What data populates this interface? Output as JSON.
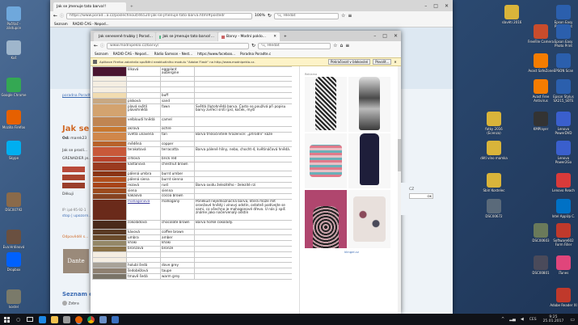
{
  "desktop": {
    "left_icons": [
      {
        "label": "Počítač - zástupce",
        "icon": "computer-icon",
        "color": "#6fa8dc"
      },
      {
        "label": "Koš",
        "icon": "recycle-bin-icon",
        "color": "#9fb6cc"
      },
      {
        "label": "Google Chrome",
        "icon": "chrome-icon",
        "color": "#34a853"
      },
      {
        "label": "Mozilla Firefox",
        "icon": "firefox-icon",
        "color": "#e66000"
      },
      {
        "label": "Skype",
        "icon": "skype-icon",
        "color": "#00aff0"
      },
      {
        "label": "DSC00792",
        "icon": "photo-icon",
        "color": "#8a6a4a"
      },
      {
        "label": "Eva Hrdinová",
        "icon": "photo-icon",
        "color": "#6a5040"
      },
      {
        "label": "Dropbox",
        "icon": "dropbox-icon",
        "color": "#0061fe"
      },
      {
        "label": "kostel",
        "icon": "photo-icon",
        "color": "#7a7a6a"
      }
    ],
    "right_icons": [
      {
        "label": "slavěti 2016",
        "icon": "folder-icon",
        "color": "#d9b43a"
      },
      {
        "label": "Epson Easy Photo Print",
        "icon": "printer-icon",
        "color": "#2b5fad"
      },
      {
        "label": "FreeFile Camera",
        "icon": "app-icon",
        "color": "#c94c2c"
      },
      {
        "label": "Epson Easy Photo Print",
        "icon": "printer-icon",
        "color": "#2b5fad"
      },
      {
        "label": "Avast SafeZone",
        "icon": "avast-icon",
        "color": "#f57c00"
      },
      {
        "label": "EPSON Scan",
        "icon": "scanner-icon",
        "color": "#2b5fad"
      },
      {
        "label": "Avast Free Antivirus",
        "icon": "avast-icon",
        "color": "#f57c00"
      },
      {
        "label": "Epson Stylus SX215_S0TE",
        "icon": "printer-icon",
        "color": "#2b5fad"
      },
      {
        "label": "fotky 2016 (Ecenza)",
        "icon": "folder-icon",
        "color": "#d9b43a"
      },
      {
        "label": "KMPlayer",
        "icon": "player-icon",
        "color": "#333333"
      },
      {
        "label": "Lenovo PowerDVD",
        "icon": "dvd-icon",
        "color": "#3a5fcd"
      },
      {
        "label": "dětí víno mamka",
        "icon": "folder-icon",
        "color": "#d9b43a"
      },
      {
        "label": "Lenovo Power2Go",
        "icon": "disc-icon",
        "color": "#3a5fcd"
      },
      {
        "label": "Sbírí Kostelec",
        "icon": "folder-icon",
        "color": "#d9b43a"
      },
      {
        "label": "Lenovo Reach",
        "icon": "app-icon",
        "color": "#d93a3a"
      },
      {
        "label": "DSC00672",
        "icon": "photo-icon",
        "color": "#5a6a7a"
      },
      {
        "label": "Intel AppUp C.",
        "icon": "app-icon",
        "color": "#0071c5"
      },
      {
        "label": "DSC00603",
        "icon": "photo-icon",
        "color": "#6a7a5a"
      },
      {
        "label": "Software602 Form Filler",
        "icon": "app-icon",
        "color": "#c0392b"
      },
      {
        "label": "DSC00801",
        "icon": "photo-icon",
        "color": "#4a4a5a"
      },
      {
        "label": "iTunes",
        "icon": "itunes-icon",
        "color": "#e0457b"
      },
      {
        "label": "Adobe Reader XI",
        "icon": "pdf-icon",
        "color": "#c0392b"
      }
    ]
  },
  "back_browser": {
    "tabs": [
      "Jak se jmenuje tato barva!!",
      "+"
    ],
    "url": "https://www.porad...a.cz/poslechnout/46520-jak-se-jmenuje-tato-barva.html#postedr",
    "zoom": "100%",
    "search_placeholder": "Hledat",
    "bookmarks": [
      "Seznam",
      "RADIO ČAS - Nepod..."
    ],
    "page": {
      "breadcrumb": "poradna Poradte...",
      "title": "Jak se j",
      "author_label": "Od:",
      "author": "marek23",
      "body_fragment": "Jak se proslí...",
      "body_fragment2": "GRENADIER je...",
      "thanks": "Děkuji",
      "ip_label": "IP: ipd-95-92-1",
      "links": "stop | upozorn...",
      "answer_link": "Odpověděl s...",
      "logo_text": "Dante",
      "section_title": "Seznam od",
      "last_item": "Zobra"
    }
  },
  "front_browser": {
    "tabs": [
      "Jak seneseně trubky | Porad...",
      "Jak se jmenuje tato barva!...",
      "Barvy - Modní poklo..."
    ],
    "new_tab": "+",
    "url": "www.modnipeklo.cz/barvy/",
    "search_placeholder": "Hledat",
    "bookmarks": [
      "Seznam",
      "RADIO ČAS - Nepod...",
      "Rádio Samson - Nest...",
      "https://www.faceboo...",
      "Poradna Poradte.c"
    ],
    "notification": {
      "text": "Aplikace Firefox zabránila spuštění neaktuálního modulu \"Adobe Flash\" na http://www.modnipeklo.cz.",
      "continue_button": "Pokračovat v blokování",
      "allow_button": "Povolit..."
    },
    "ad": {
      "header": "Reklama",
      "footer": "klingel.cz",
      "sidebar_text": "CZ",
      "sidebar_ok": "OK"
    },
    "colors": [
      {
        "name": "lilková",
        "en": "eggplant aubergine",
        "desc": "",
        "swatch": "#4a1530"
      },
      {
        "name": "",
        "en": "",
        "desc": "",
        "swatch": "#f5eee2"
      },
      {
        "name": "",
        "en": "",
        "desc": "",
        "swatch": "#f5eee2"
      },
      {
        "name": "",
        "en": "",
        "desc": "",
        "swatch": "#f5eee2"
      },
      {
        "name": "",
        "en": "buff",
        "desc": "",
        "swatch": "#f1dcb0"
      },
      {
        "name": "písková",
        "en": "sand",
        "desc": "",
        "swatch": "#c8a882"
      },
      {
        "name": "plavá světlí plavohnědá",
        "en": "fawn",
        "desc": "Světlá žlutohnědá barva. Často se používá při popisu barvy zvířecí srsti (psí, koček, myší",
        "swatch": "#d3a36f"
      },
      {
        "name": "velbloudí hnědá",
        "en": "camel",
        "desc": "",
        "swatch": "#c08552"
      },
      {
        "name": "okrová",
        "en": "ochre",
        "desc": "",
        "swatch": "#c87830"
      },
      {
        "name": "světlá unavená",
        "en": "tan",
        "desc": "Barva třísločinitelé hrazenice: „přírodní\" kůže",
        "swatch": "#d0874a"
      },
      {
        "name": "měděná",
        "en": "copper",
        "desc": "",
        "swatch": "#b8622a"
      },
      {
        "name": "terakotová",
        "en": "terracotta",
        "desc": "Barva pálené hlíny, nebo, chocht-4, květináčová hnědá.",
        "swatch": "#c8583a"
      },
      {
        "name": "cihlová",
        "en": "brick red",
        "desc": "",
        "swatch": "#b8422c"
      },
      {
        "name": "kaštanová",
        "en": "chestnut brown",
        "desc": "",
        "swatch": "#9a3a20"
      },
      {
        "name": "pálená umbra",
        "en": "burnt umber",
        "desc": "",
        "swatch": "#8a3414"
      },
      {
        "name": "pálená siena",
        "en": "burnt sienna",
        "desc": "",
        "swatch": "#b04e1c"
      },
      {
        "name": "rezavá",
        "en": "rust",
        "desc": "Barva oxidu železitého - železité rzi",
        "swatch": "#a84418"
      },
      {
        "name": "siena",
        "en": "sienna",
        "desc": "",
        "swatch": "#9c4a1c"
      },
      {
        "name": "kakaová",
        "en": "cocoa brown",
        "desc": "",
        "swatch": "#874321"
      },
      {
        "name": "mahagonová",
        "en": "mahogany",
        "desc": "Poněkud nejednoznačná barva, která může mít oranžové hnědý i vínový odstín, ostatně podívejte se sami, co všechno je mahagonové dřevo. U nás ji spíš známe jako načervenalý odstín",
        "swatch": "#6a2a1a"
      },
      {
        "name": "čokoládová",
        "en": "chocolate brown",
        "desc": "Barva hořké čokolády.",
        "swatch": "#4a2a1a"
      },
      {
        "name": "kávová",
        "en": "coffee brown",
        "desc": "",
        "swatch": "#5a3a24"
      },
      {
        "name": "umbra",
        "en": "amber",
        "desc": "",
        "swatch": "#6a4a2a"
      },
      {
        "name": "khaki",
        "en": "khaki",
        "desc": "",
        "swatch": "#948768"
      },
      {
        "name": "bronzová",
        "en": "bronze",
        "desc": "",
        "swatch": "#8a7248"
      },
      {
        "name": "",
        "en": "",
        "desc": "",
        "swatch": "#f5eee2"
      },
      {
        "name": "",
        "en": "",
        "desc": "",
        "swatch": "#f5eee2"
      },
      {
        "name": "holubí šedá",
        "en": "dove grey",
        "desc": "",
        "swatch": "#a8a298"
      },
      {
        "name": "šedobéžová",
        "en": "taupe",
        "desc": "",
        "swatch": "#8e8070"
      },
      {
        "name": "tmavě šedá",
        "en": "warm grey",
        "desc": "",
        "swatch": "#7a7468"
      }
    ]
  },
  "taskbar": {
    "time": "9:25",
    "date": "25.01.2017",
    "lang": "CES"
  }
}
